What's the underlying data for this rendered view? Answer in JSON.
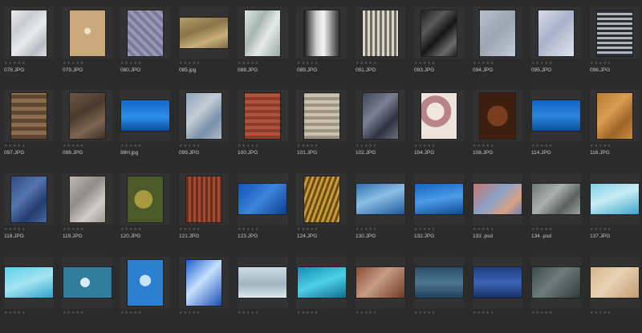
{
  "colors": {
    "background": "#2b2b2b",
    "cell_background": "#323232",
    "label_text": "#c8c8c8",
    "star_empty": "#5d5d5d"
  },
  "rating_glyphs": "★★★★★",
  "thumbnails": [
    {
      "label": "078.JPG",
      "orientation": "portrait",
      "fill": "linear-gradient(135deg,#ececee 0%,#c9cbd0 30%,#e9eaed 55%,#b8bbc1 80%,#dfe0e3 100%)"
    },
    {
      "label": "079.JPG",
      "orientation": "portrait",
      "fill": "radial-gradient(circle at 50% 45%,#f0e2c4 0 10%,#c9a97a 11% 100%)"
    },
    {
      "label": "080.JPG",
      "orientation": "portrait",
      "fill": "repeating-linear-gradient(45deg,#9a98b4 0 4px,#7c7a99 4px 8px)"
    },
    {
      "label": "085.jpg",
      "orientation": "landscape",
      "fill": "linear-gradient(160deg,#b59c6a 0%,#8a7448 40%,#c8b07a 70%,#7d6a45 100%)"
    },
    {
      "label": "088.JPG",
      "orientation": "portrait",
      "fill": "linear-gradient(120deg,#dfe6e4 0%,#a9b5b2 35%,#e4ebe9 60%,#9aa8a5 100%)"
    },
    {
      "label": "089.JPG",
      "orientation": "portrait",
      "fill": "linear-gradient(90deg,#1c1c1c 0%,#cfcfcf 35%,#f5f5f5 55%,#2a2a2a 100%)"
    },
    {
      "label": "091.JPG",
      "orientation": "portrait",
      "fill": "repeating-linear-gradient(90deg,#d9d6cc 0 3px,#6f6c63 3px 6px)"
    },
    {
      "label": "093.JPG",
      "orientation": "portrait",
      "fill": "linear-gradient(135deg,#1e1e1e 0%,#5a5a5a 30%,#151515 55%,#6a6a6a 80%,#222 100%)"
    },
    {
      "label": "094.JPG",
      "orientation": "portrait",
      "fill": "linear-gradient(135deg,#b8c2cc 0%,#9aa5b1 50%,#c4cdd6 100%)"
    },
    {
      "label": "095.JPG",
      "orientation": "portrait",
      "fill": "linear-gradient(135deg,#d8dcea 0%,#aab1c9 45%,#e2e5f0 100%)"
    },
    {
      "label": "096.JPG",
      "orientation": "portrait",
      "fill": "repeating-linear-gradient(0deg,#2a2e33 0 3px,#aeb4bb 3px 6px)"
    },
    {
      "label": "097.JPG",
      "orientation": "portrait",
      "fill": "repeating-linear-gradient(0deg,#5e4630 0 5px,#8b6c4c 5px 10px)"
    },
    {
      "label": "098.JPG",
      "orientation": "portrait",
      "fill": "linear-gradient(150deg,#6d5744 0%,#4a3a2c 40%,#7d6652 70%,#3d2f23 100%)"
    },
    {
      "label": "98H.jpg",
      "orientation": "landscape",
      "fill": "linear-gradient(180deg,#1468c8 0%,#2b8ee8 55%,#0a4fa3 100%)"
    },
    {
      "label": "099.JPG",
      "orientation": "portrait",
      "fill": "linear-gradient(135deg,#8fa6bf 0%,#c2ccd3 40%,#7890aa 70%,#b0bcc6 100%)"
    },
    {
      "label": "100.JPG",
      "orientation": "portrait",
      "fill": "repeating-linear-gradient(0deg,#8d3b2a 0 4px,#b0543b 4px 8px)"
    },
    {
      "label": "101.JPG",
      "orientation": "portrait",
      "fill": "repeating-linear-gradient(0deg,#9b9483 0 4px,#c9c2ad 4px 8px)"
    },
    {
      "label": "102.JPG",
      "orientation": "portrait",
      "fill": "linear-gradient(135deg,#3f4352 0%,#7c8094 40%,#2f3240 70%,#6b6f80 100%)"
    },
    {
      "label": "104.JPG",
      "orientation": "portrait",
      "fill": "radial-gradient(circle at 40% 40%,#f1e7df 0 25%,#b8838a 26% 45%,#ece3dc 46% 100%)"
    },
    {
      "label": "108.JPG",
      "orientation": "portrait",
      "fill": "radial-gradient(circle,#7a3d1d 0 35%,#3e1f0f 36% 100%)"
    },
    {
      "label": "114.JPG",
      "orientation": "landscape",
      "fill": "linear-gradient(180deg,#0f63c4 0%,#2d87e0 50%,#0b4fa0 100%)"
    },
    {
      "label": "116.JPG",
      "orientation": "portrait",
      "fill": "linear-gradient(135deg,#b87b35 0%,#d89c52 40%,#9e6428 70%,#c88c44 100%)"
    },
    {
      "label": "118.JPG",
      "orientation": "portrait",
      "fill": "linear-gradient(135deg,#2f4a86 0%,#5574ad 40%,#243c70 70%,#4a67a0 100%)"
    },
    {
      "label": "119.JPG",
      "orientation": "portrait",
      "fill": "linear-gradient(135deg,#bdbab3 0%,#8f8c86 40%,#d0cdc6 70%,#9d9a93 100%)"
    },
    {
      "label": "120.JPG",
      "orientation": "portrait",
      "fill": "radial-gradient(circle at 45% 50%,#a59b3e 0 30%,#4c5a2a 31% 100%)"
    },
    {
      "label": "121.JPG",
      "orientation": "portrait",
      "fill": "repeating-linear-gradient(90deg,#6e2e1f 0 3px,#a34a30 3px 6px)"
    },
    {
      "label": "123.JPG",
      "orientation": "landscape",
      "fill": "linear-gradient(135deg,#0f55b8 0%,#3b84db 50%,#0a3f8e 100%)"
    },
    {
      "label": "124.JPG",
      "orientation": "portrait",
      "fill": "repeating-linear-gradient(110deg,#6b4c12 0 3px,#c79a3b 3px 6px)"
    },
    {
      "label": "130.JPG",
      "orientation": "landscape",
      "fill": "linear-gradient(160deg,#2f6fb0 0%,#8bbfe6 45%,#1f5a98 100%)"
    },
    {
      "label": "132.JPG",
      "orientation": "landscape",
      "fill": "linear-gradient(170deg,#1463c0 0%,#4c9be6 50%,#0d4a98 100%)"
    },
    {
      "label": "133 .psd",
      "orientation": "landscape",
      "fill": "linear-gradient(135deg,#c6736d 0%,#8aa3c9 45%,#d8a184 75%,#6d7fb0 100%)"
    },
    {
      "label": "134 .psd",
      "orientation": "landscape",
      "fill": "linear-gradient(135deg,#6f7674 0%,#a9b0ad 40%,#5a615f 70%,#9aa19e 100%)"
    },
    {
      "label": "137.JPG",
      "orientation": "landscape",
      "fill": "linear-gradient(160deg,#7fd0e8 0%,#c8ecf5 45%,#3aa7c9 100%)"
    },
    {
      "label": "",
      "orientation": "landscape",
      "fill": "linear-gradient(160deg,#5ad0ea 0%,#a6e4f3 50%,#2aa2c8 100%)"
    },
    {
      "label": "",
      "orientation": "landscape",
      "fill": "radial-gradient(circle at 45% 50%,#d8eef4 0 15%,#2f7f9c 16% 100%)"
    },
    {
      "label": "",
      "orientation": "portrait",
      "fill": "radial-gradient(circle at 50% 45%,#c9e3f8 0 18%,#2c7fd1 19% 100%)"
    },
    {
      "label": "",
      "orientation": "portrait",
      "fill": "linear-gradient(135deg,#1f5fcf 0%,#c6e0ff 45%,#1a4fb1 100%)"
    },
    {
      "label": "",
      "orientation": "landscape",
      "fill": "linear-gradient(180deg,#cfdde2 0%,#9fb6bf 55%,#dde8ec 100%)"
    },
    {
      "label": "",
      "orientation": "landscape",
      "fill": "linear-gradient(160deg,#0d8fb3 0%,#4fd0e6 50%,#0b6f92 100%)"
    },
    {
      "label": "",
      "orientation": "landscape",
      "fill": "linear-gradient(135deg,#8a4b35 0%,#c99c86 45%,#6e3a27 100%)"
    },
    {
      "label": "",
      "orientation": "landscape",
      "fill": "linear-gradient(180deg,#2c4f68 0%,#4d7591 50%,#22405a 100%)"
    },
    {
      "label": "",
      "orientation": "landscape",
      "fill": "linear-gradient(180deg,#1e3c82 0%,#3e64b2 50%,#172f6a 100%)"
    },
    {
      "label": "",
      "orientation": "landscape",
      "fill": "linear-gradient(135deg,#3b4a4a 0%,#6d7d7b 45%,#2d3a3a 100%)"
    },
    {
      "label": "",
      "orientation": "landscape",
      "fill": "linear-gradient(135deg,#d4b48e 0%,#e8d2b4 45%,#c49c72 100%)"
    }
  ]
}
